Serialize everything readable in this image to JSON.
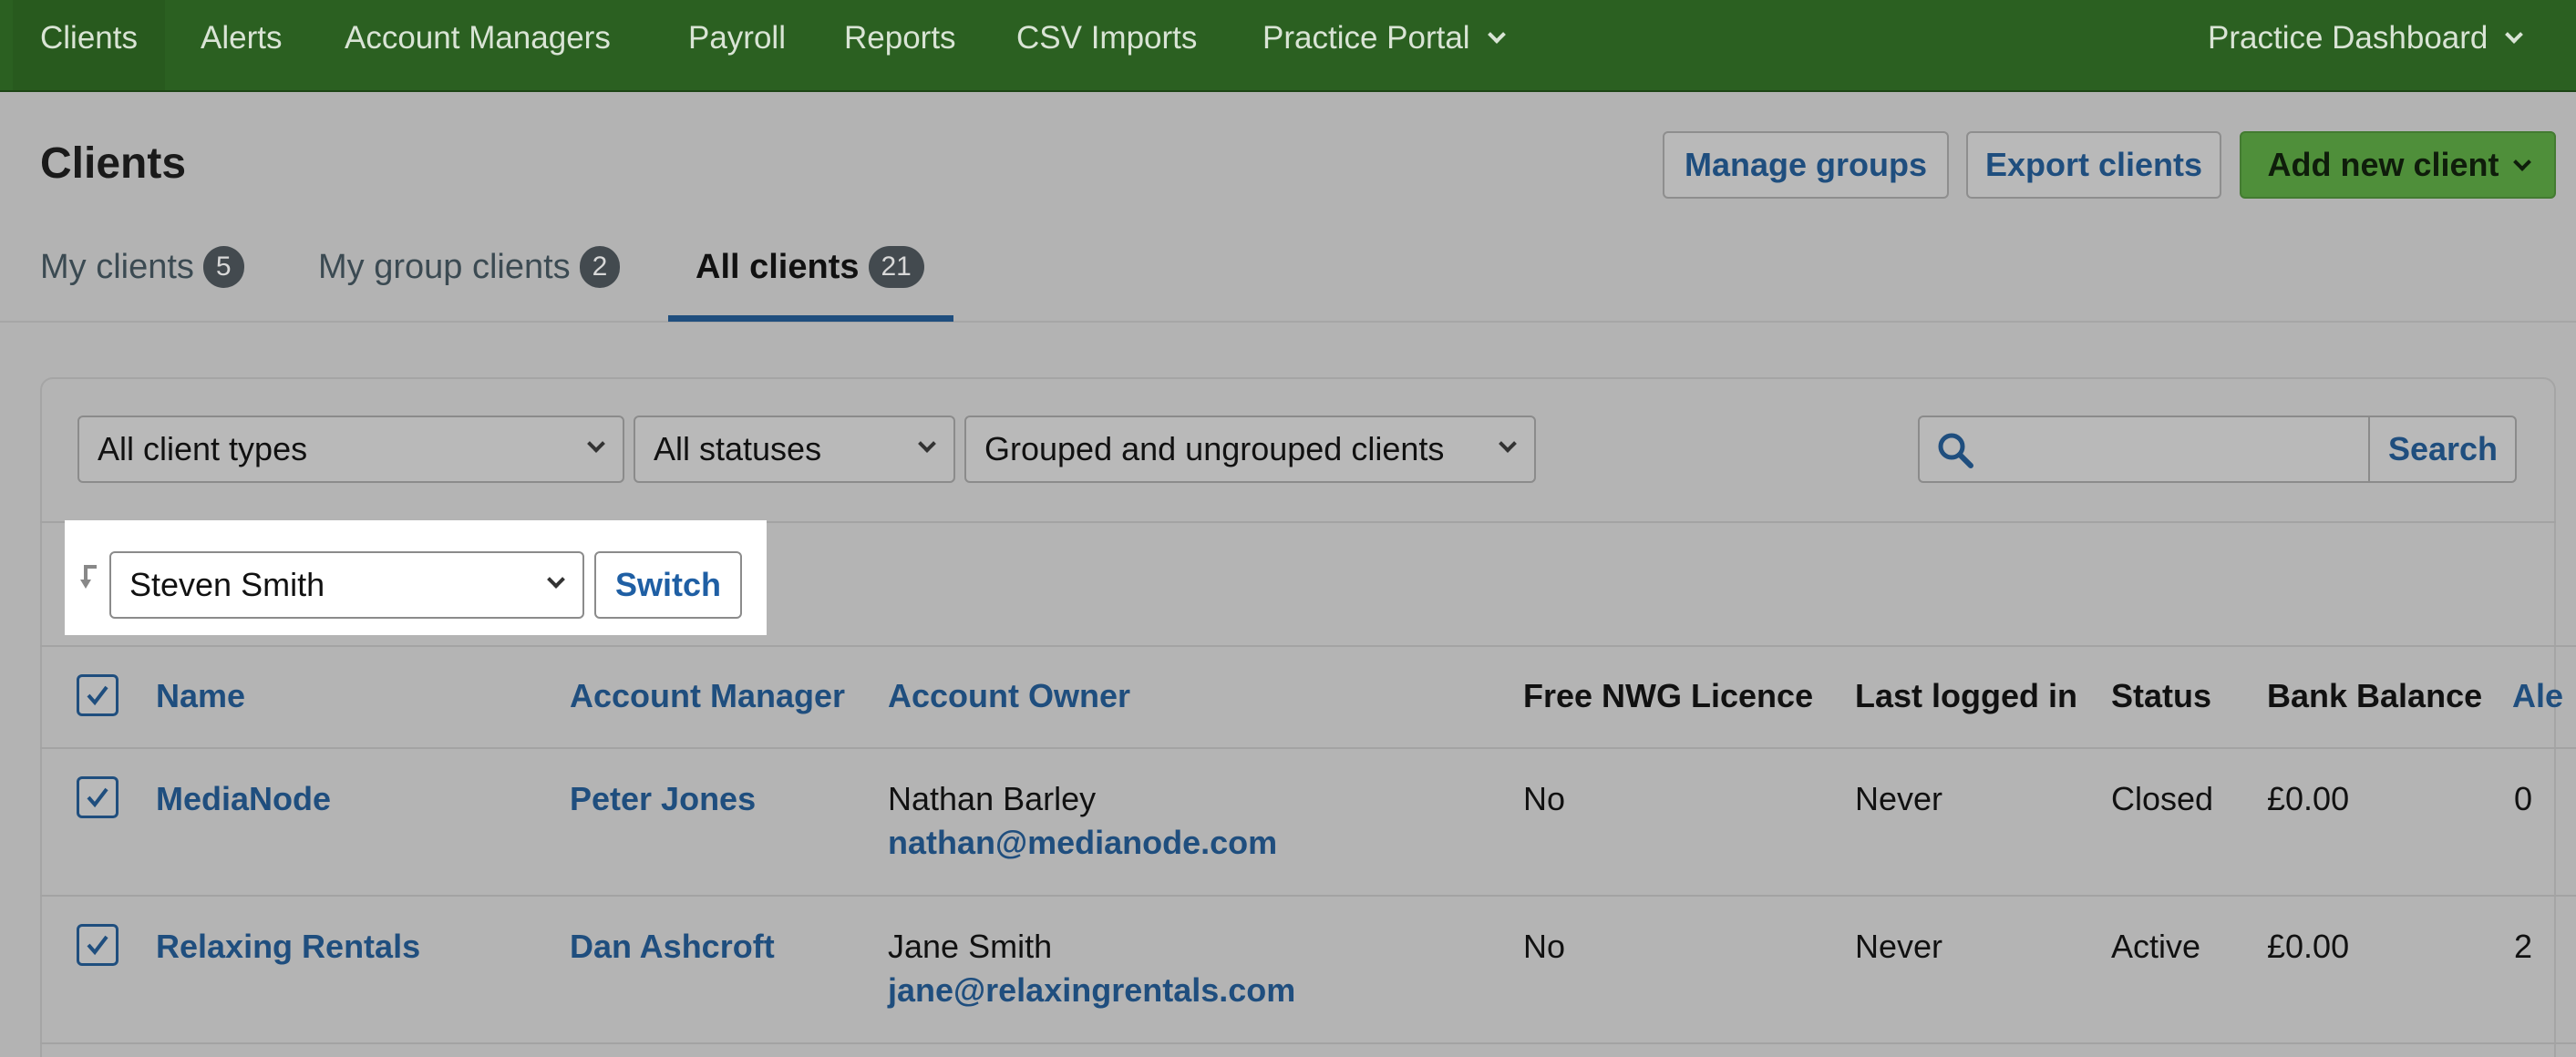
{
  "nav": {
    "items": [
      "Clients",
      "Alerts",
      "Account Managers",
      "Payroll",
      "Reports",
      "CSV Imports",
      "Practice Portal"
    ],
    "right": "Practice Dashboard"
  },
  "page": {
    "title": "Clients",
    "buttons": {
      "manage_groups": "Manage groups",
      "export_clients": "Export clients",
      "add_new_client": "Add new client"
    }
  },
  "tabs": [
    {
      "label": "My clients",
      "count": "5"
    },
    {
      "label": "My group clients",
      "count": "2"
    },
    {
      "label": "All clients",
      "count": "21"
    }
  ],
  "filters": {
    "client_types": "All client types",
    "statuses": "All statuses",
    "grouping": "Grouped and ungrouped clients",
    "search_placeholder": "",
    "search_button": "Search"
  },
  "switcher": {
    "selected": "Steven Smith",
    "button": "Switch"
  },
  "table": {
    "headers": [
      "Name",
      "Account Manager",
      "Account Owner",
      "Free NWG Licence",
      "Last logged in",
      "Status",
      "Bank Balance",
      "Ale"
    ],
    "rows": [
      {
        "name": "MediaNode",
        "manager": "Peter Jones",
        "owner_name": "Nathan Barley",
        "owner_email": "nathan@medianode.com",
        "licence": "No",
        "last_login": "Never",
        "status": "Closed",
        "balance": "£0.00",
        "alerts": "0"
      },
      {
        "name": "Relaxing Rentals",
        "manager": "Dan Ashcroft",
        "owner_name": "Jane Smith",
        "owner_email": "jane@relaxingrentals.com",
        "licence": "No",
        "last_login": "Never",
        "status": "Active",
        "balance": "£0.00",
        "alerts": "2"
      }
    ]
  },
  "colors": {
    "nav_bg": "#2b6021",
    "primary_button": "#4f8f3a",
    "link": "#1f4e7e"
  }
}
